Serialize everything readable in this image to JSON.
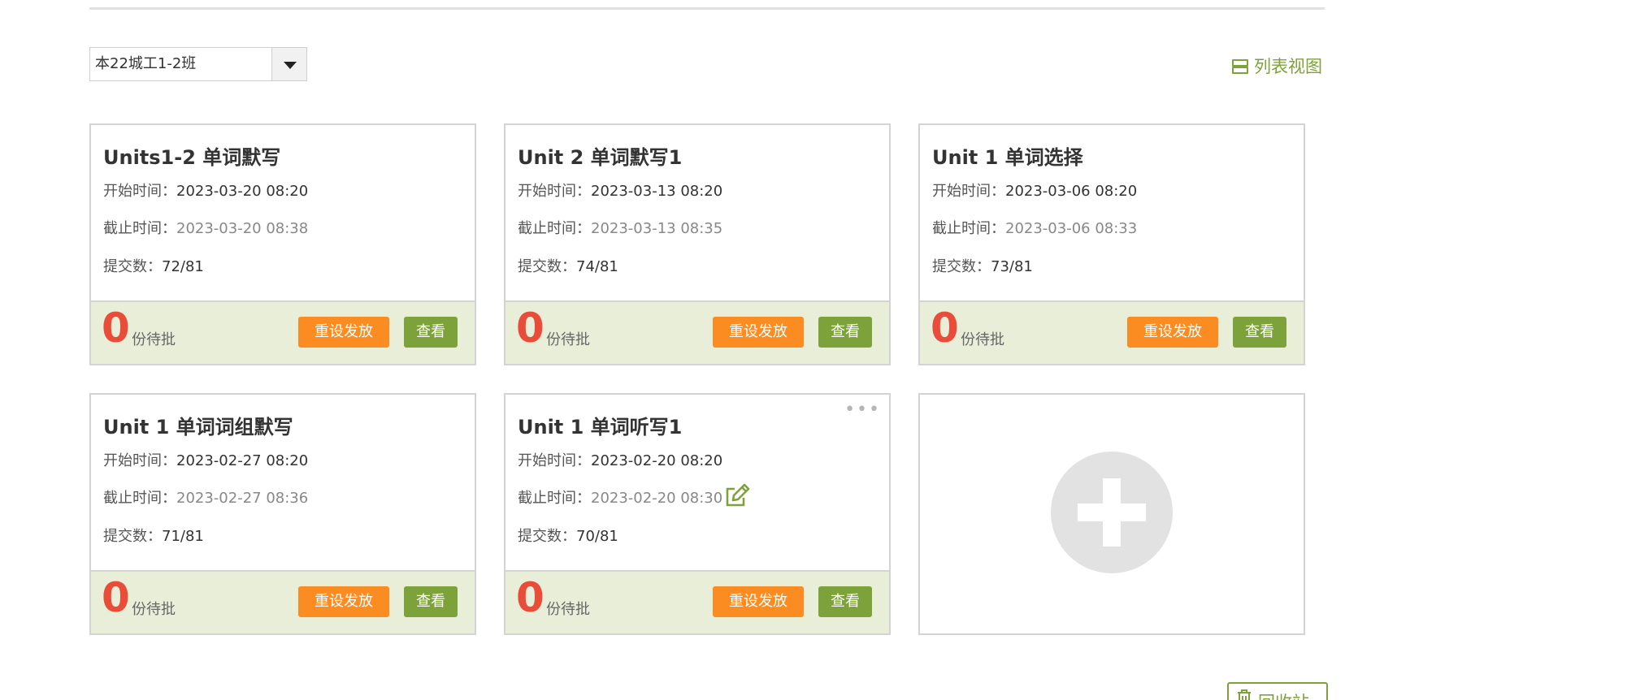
{
  "toolbar": {
    "class_select": "本22城工1-2班",
    "list_view_label": "列表视图"
  },
  "labels": {
    "start": "开始时间：",
    "end": "截止时间：",
    "submit": "提交数：",
    "pending": "份待批",
    "reset_button": "重设发放",
    "view_button": "查看",
    "more": "•••"
  },
  "cards": [
    {
      "title": "Units1-2 单词默写",
      "start": "2023-03-20 08:20",
      "end": "2023-03-20 08:38",
      "submissions": "72/81",
      "pending_count": "0"
    },
    {
      "title": "Unit 2 单词默写1",
      "start": "2023-03-13 08:20",
      "end": "2023-03-13 08:35",
      "submissions": "74/81",
      "pending_count": "0"
    },
    {
      "title": "Unit 1 单词选择",
      "start": "2023-03-06 08:20",
      "end": "2023-03-06 08:33",
      "submissions": "73/81",
      "pending_count": "0"
    },
    {
      "title": "Unit 1 单词词组默写",
      "start": "2023-02-27 08:20",
      "end": "2023-02-27 08:36",
      "submissions": "71/81",
      "pending_count": "0"
    },
    {
      "title": "Unit 1 单词听写1",
      "start": "2023-02-20 08:20",
      "end": "2023-02-20 08:30",
      "submissions": "70/81",
      "pending_count": "0"
    }
  ],
  "recycle_bin_label": "回收站",
  "colors": {
    "accent_green": "#7ea23a",
    "accent_orange": "#fb8c22",
    "count_red": "#e94d3a",
    "footer_bg": "#e8eed8"
  }
}
